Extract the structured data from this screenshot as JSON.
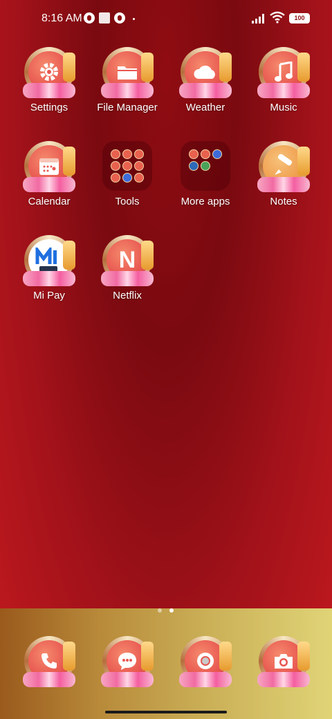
{
  "status_bar": {
    "time": "8:16 AM",
    "battery": "100",
    "icons": [
      "notification-icon",
      "square-notification-icon",
      "notification-icon",
      "signal-icon",
      "wifi-icon",
      "battery-icon"
    ]
  },
  "apps": {
    "settings": {
      "label": "Settings",
      "icon": "gear-icon"
    },
    "file_manager": {
      "label": "File Manager",
      "icon": "folder-icon"
    },
    "weather": {
      "label": "Weather",
      "icon": "cloud-icon"
    },
    "music": {
      "label": "Music",
      "icon": "music-note-icon"
    },
    "calendar": {
      "label": "Calendar",
      "icon": "calendar-icon"
    },
    "tools": {
      "label": "Tools",
      "icon": "folder-grid-icon"
    },
    "more_apps": {
      "label": "More apps",
      "icon": "folder-grid-icon"
    },
    "notes": {
      "label": "Notes",
      "icon": "notes-icon"
    },
    "mi_pay": {
      "label": "Mi Pay",
      "icon": "mi-pay-icon"
    },
    "netflix": {
      "label": "Netflix",
      "icon": "netflix-n-icon",
      "glyph": "N"
    }
  },
  "dock": {
    "phone": {
      "icon": "phone-icon"
    },
    "messages": {
      "icon": "chat-bubble-icon"
    },
    "browser": {
      "icon": "browser-icon"
    },
    "camera": {
      "icon": "camera-icon"
    }
  },
  "pager": {
    "pages": 2,
    "current": 2
  },
  "colors": {
    "background_top": "#7a0a10",
    "background_bottom": "#c11a1f",
    "icon_disk": "#e85750",
    "dock_left": "#9a5a1c",
    "dock_right": "#e0d477"
  }
}
